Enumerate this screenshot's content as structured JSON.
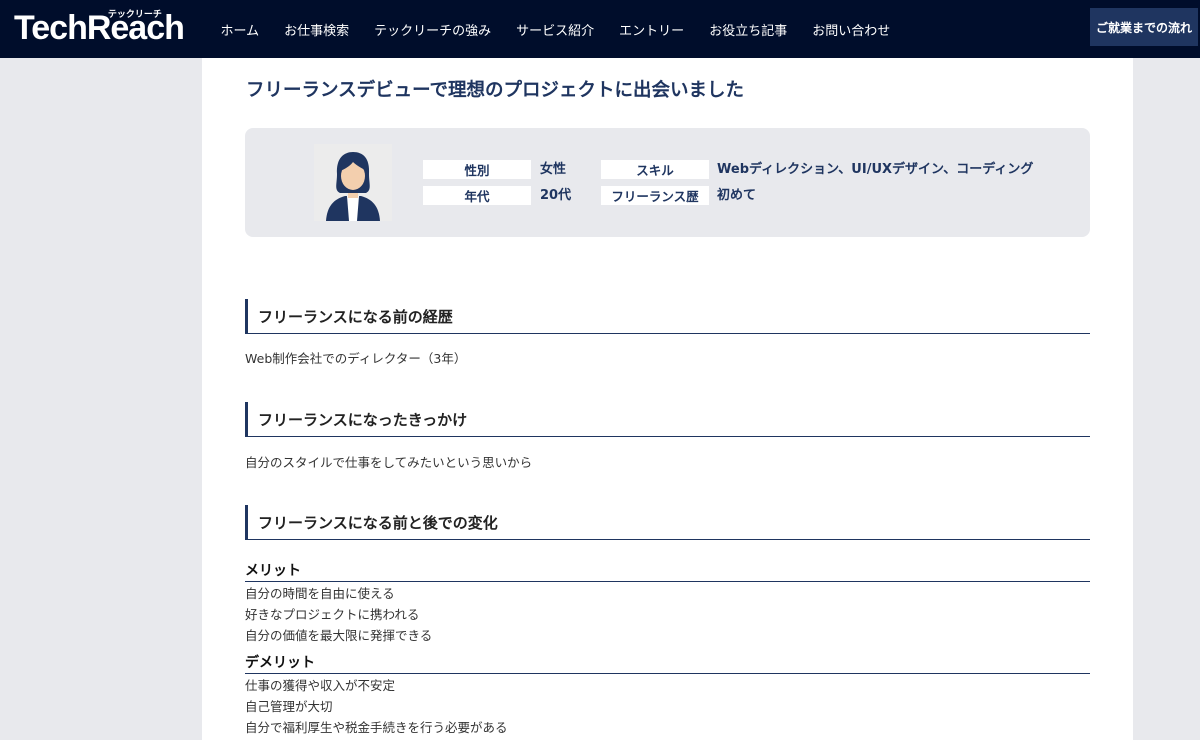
{
  "header": {
    "logo": "TechReach",
    "logo_kana": "テックリーチ",
    "nav": [
      "ホーム",
      "お仕事検索",
      "テックリーチの強み",
      "サービス紹介",
      "エントリー",
      "お役立ち記事",
      "お問い合わせ"
    ],
    "cta_label": "ご就業までの流れ"
  },
  "article": {
    "title": "フリーランスデビューで理想のプロジェクトに出会いました",
    "profile": {
      "gender_label": "性別",
      "gender_value": "女性",
      "age_label": "年代",
      "age_value": "20代",
      "skill_label": "スキル",
      "skill_value": "Webディレクション、UI/UXデザイン、コーディング",
      "history_label": "フリーランス歴",
      "history_value": "初めて"
    },
    "sections": [
      {
        "heading": "フリーランスになる前の経歴",
        "text": "Web制作会社でのディレクター（3年）"
      },
      {
        "heading": "フリーランスになったきっかけ",
        "text": "自分のスタイルで仕事をしてみたいという思いから"
      },
      {
        "heading": "フリーランスになる前と後での変化"
      }
    ],
    "merit": {
      "heading": "メリット",
      "items": [
        "自分の時間を自由に使える",
        "好きなプロジェクトに携われる",
        "自分の価値を最大限に発揮できる"
      ]
    },
    "demerit": {
      "heading": "デメリット",
      "items": [
        "仕事の獲得や収入が不安定",
        "自己管理が大切",
        "自分で福利厚生や税金手続きを行う必要がある"
      ]
    }
  },
  "colors": {
    "header_bg": "#000d2b",
    "accent": "#1f3560",
    "page_bg": "#e8e9ed"
  }
}
